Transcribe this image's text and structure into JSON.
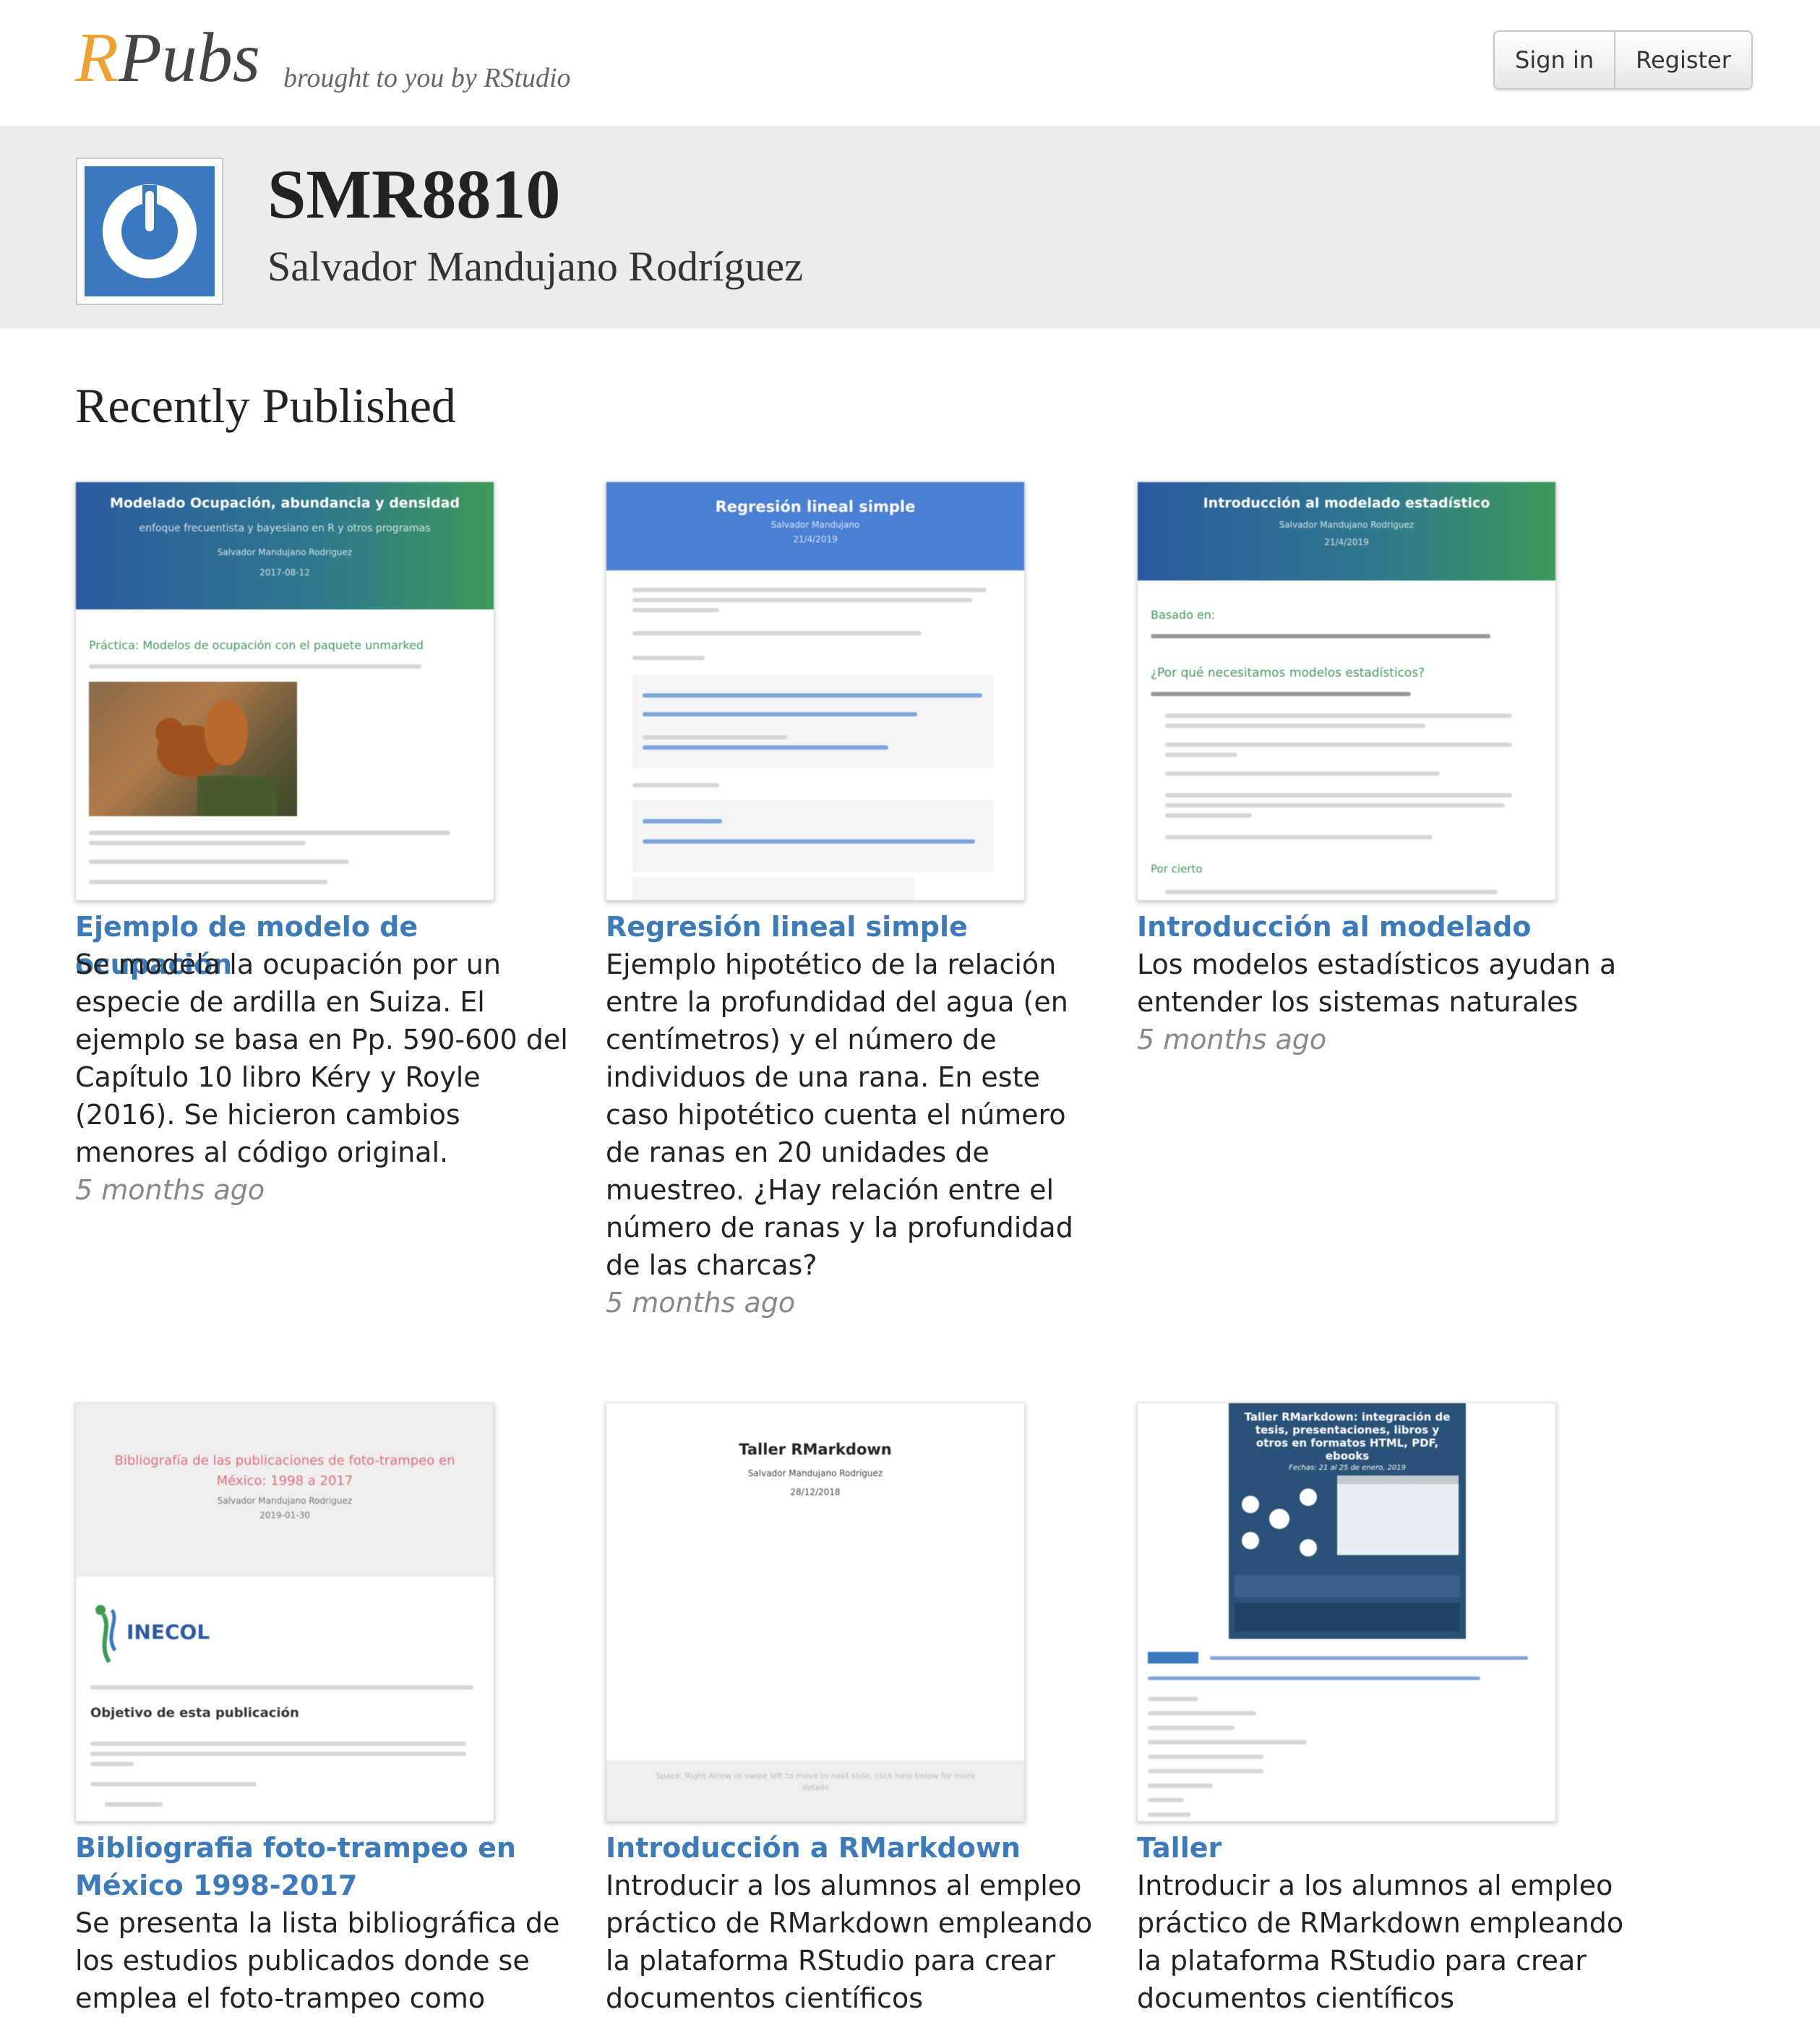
{
  "header": {
    "logo_r": "R",
    "logo_rest": "Pubs",
    "tagline": "brought to you by RStudio",
    "sign_in": "Sign in",
    "register": "Register"
  },
  "profile": {
    "username": "SMR8810",
    "full_name": "Salvador Mandujano Rodríguez"
  },
  "section_title": "Recently Published",
  "cards": [
    {
      "title": "Ejemplo de modelo de ocupación",
      "description": "Se modela la ocupación por un especie de ardilla en Suiza. El ejemplo se basa en Pp. 590-600 del Capítulo 10 libro Kéry y Royle (2016). Se hicieron cambios menores al código original.",
      "time": "5 months ago",
      "thumb_title": "Modelado Ocupación, abundancia y densidad",
      "thumb_subtitle": "enfoque frecuentista y bayesiano en R y otros programas",
      "thumb_author": "Salvador Mandujano Rodriguez",
      "thumb_date": "2017-08-12",
      "thumb_heading": "Práctica: Modelos de ocupación con el paquete unmarked"
    },
    {
      "title": "Regresión lineal simple",
      "description": "Ejemplo hipotético de la relación entre la profundidad del agua (en centímetros) y el número de individuos de una rana. En este caso hipotético cuenta el número de ranas en 20 unidades de muestreo. ¿Hay relación entre el número de ranas y la profundidad de las charcas?",
      "time": "5 months ago",
      "thumb_title": "Regresión lineal simple",
      "thumb_author": "Salvador Mandujano",
      "thumb_date": "21/4/2019"
    },
    {
      "title": "Introducción al modelado",
      "description": "Los modelos estadísticos ayudan a entender los sistemas naturales",
      "time": "5 months ago",
      "thumb_title": "Introducción al modelado estadístico",
      "thumb_author": "Salvador Mandujano Rodriguez",
      "thumb_date": "21/4/2019",
      "thumb_basado": "Basado en:",
      "thumb_q": "¿Por qué necesitamos modelos estadísticos?",
      "thumb_cierto": "Por cierto"
    },
    {
      "title": "Bibliografia foto-trampeo en México 1998-2017",
      "description": "Se presenta la lista bibliográfica de los estudios publicados donde se emplea el foto-trampeo como",
      "time": "",
      "thumb_title": "Bibliografía de las publicaciones de foto-trampeo en México: 1998 a 2017",
      "thumb_author": "Salvador Mandujano Rodriguez",
      "thumb_date": "2019-01-30",
      "thumb_logo": "INECOL",
      "thumb_heading": "Objetivo de esta publicación"
    },
    {
      "title": "Introducción a RMarkdown",
      "description": "Introducir a los alumnos al empleo práctico de RMarkdown empleando la plataforma RStudio para crear documentos científicos",
      "time": "",
      "thumb_title": "Taller RMarkdown",
      "thumb_author": "Salvador Mandujano Rodríguez",
      "thumb_date": "28/12/2018",
      "thumb_footer": "Space, Right Arrow or swipe left to move to next slide, click help below for more details"
    },
    {
      "title": "Taller",
      "description": "Introducir a los alumnos al empleo práctico de RMarkdown empleando la plataforma RStudio para crear documentos científicos",
      "time": "",
      "thumb_title": "Taller RMarkdown: integración de tesis, presentaciones, libros y otros en formatos HTML, PDF, ebooks",
      "thumb_dates": "Fechas: 21 al 25 de enero, 2019"
    }
  ],
  "colors": {
    "link": "#3d7ab8",
    "logo_accent": "#eea236",
    "band": "#ececec"
  }
}
